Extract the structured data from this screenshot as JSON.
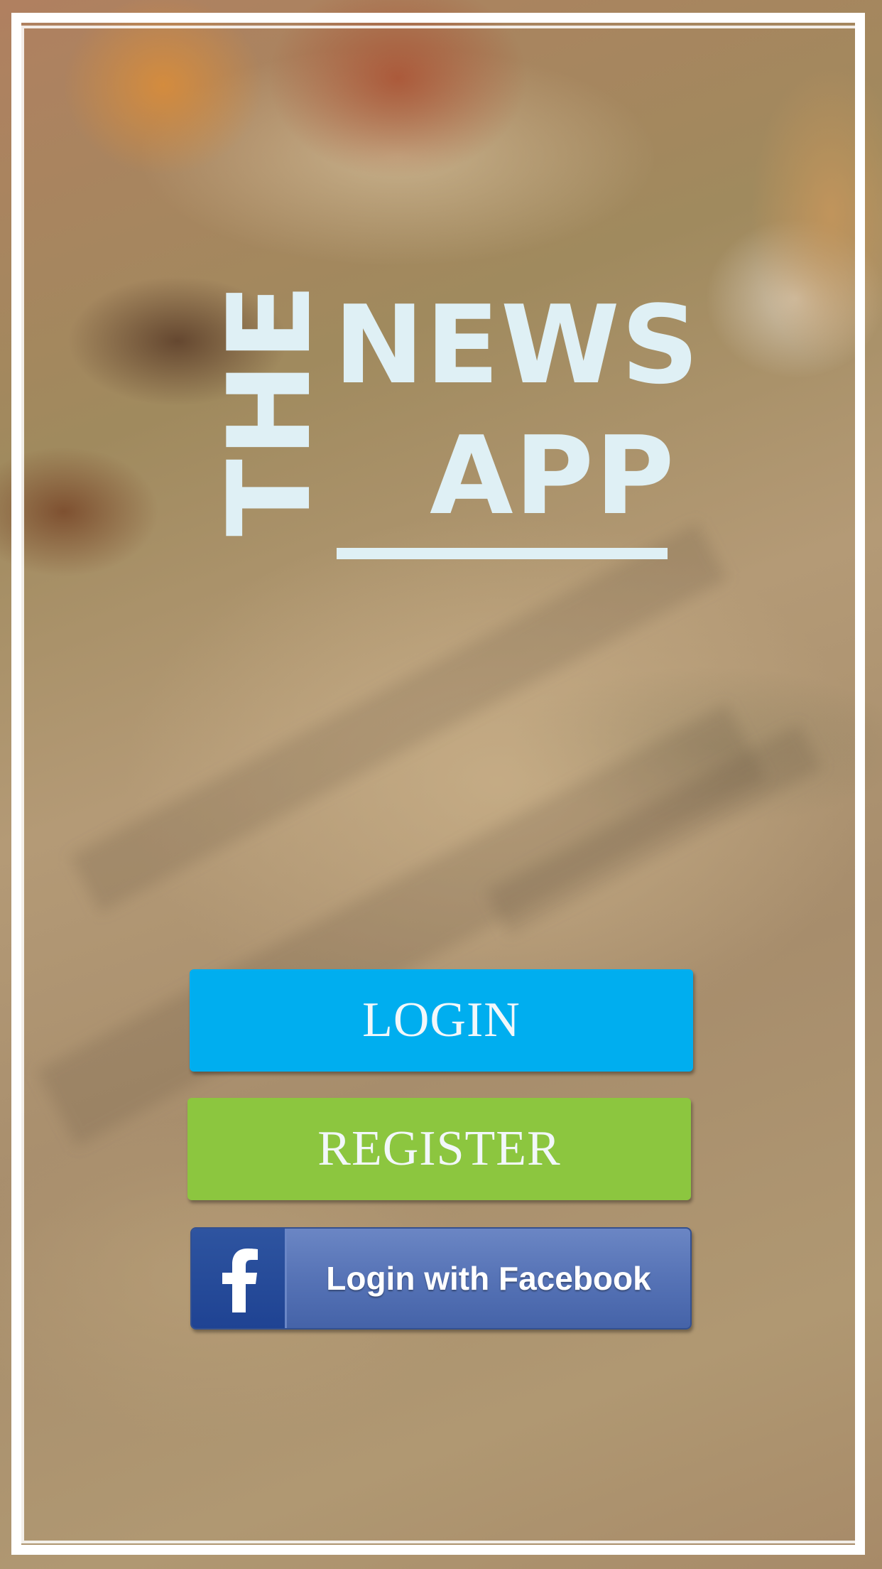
{
  "logo": {
    "the": "THE",
    "news": "NEWS",
    "app": "APP"
  },
  "buttons": {
    "login": "LOGIN",
    "register": "REGISTER",
    "facebook": "Login with Facebook"
  },
  "colors": {
    "login": "#00aeef",
    "register": "#8cc63f",
    "facebook": "#4e6cb2",
    "logo_text": "#dff0f5",
    "frame": "#ffffff"
  },
  "icons": {
    "facebook": "facebook-f-icon"
  }
}
